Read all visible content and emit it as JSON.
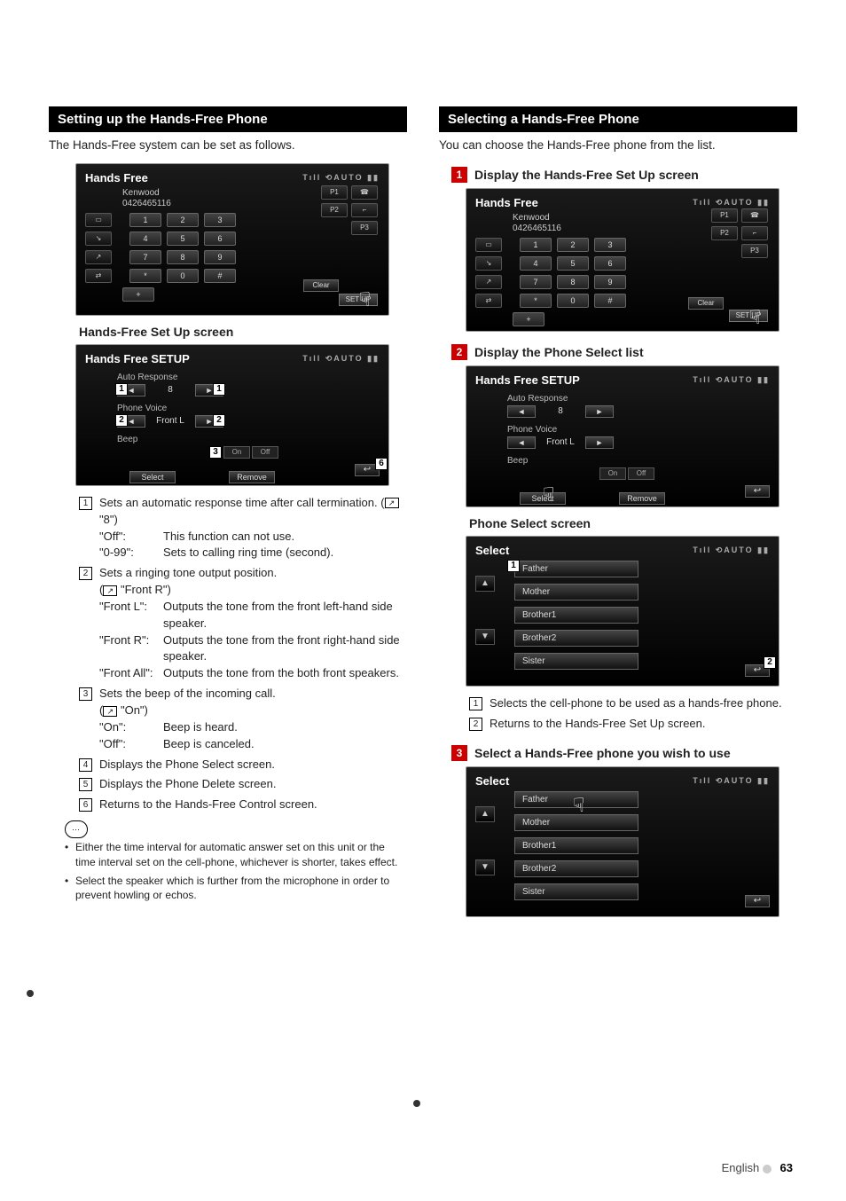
{
  "left": {
    "section_title": "Setting up the Hands-Free Phone",
    "intro": "The Hands-Free system can be set as follows.",
    "ss1": {
      "title": "Hands Free",
      "brand": "Kenwood",
      "number": "0426465116",
      "keys_r1": [
        "1",
        "2",
        "3"
      ],
      "keys_r2": [
        "4",
        "5",
        "6"
      ],
      "keys_r3": [
        "7",
        "8",
        "9"
      ],
      "keys_r4": [
        "*",
        "0",
        "#"
      ],
      "presets": [
        "P1",
        "P2",
        "P3"
      ],
      "clear": "Clear",
      "setup": "SET UP",
      "plus": "+"
    },
    "ss1_caption": "Hands-Free Set Up screen",
    "ss2": {
      "title": "Hands Free SETUP",
      "row1_label": "Auto Response",
      "row1_value": "8",
      "row2_label": "Phone Voice",
      "row2_value": "Front L",
      "row3_label": "Beep",
      "beep_on": "On",
      "beep_off": "Off",
      "select": "Select",
      "remove": "Remove"
    },
    "items": [
      {
        "n": "1",
        "text": "Sets an automatic response time after call termination. (",
        "setting": "\"8\")",
        "subs": [
          {
            "label": "\"Off\":",
            "desc": "This function can not use."
          },
          {
            "label": "\"0-99\":",
            "desc": "Sets to calling ring time (second)."
          }
        ]
      },
      {
        "n": "2",
        "text": "Sets a ringing tone output position.",
        "setting_only": "\"Front R\")",
        "subs": [
          {
            "label": "\"Front L\":",
            "desc": "Outputs the tone from the front left-hand side speaker."
          },
          {
            "label": "\"Front R\":",
            "desc": "Outputs the tone from the front right-hand side speaker."
          },
          {
            "label": "\"Front All\":",
            "desc": "Outputs the tone from the both front speakers."
          }
        ]
      },
      {
        "n": "3",
        "text": "Sets the beep of the incoming call.",
        "setting_only": "\"On\")",
        "subs": [
          {
            "label": "\"On\":",
            "desc": "Beep is heard."
          },
          {
            "label": "\"Off\":",
            "desc": "Beep is canceled."
          }
        ]
      },
      {
        "n": "4",
        "text": "Displays the Phone Select screen."
      },
      {
        "n": "5",
        "text": "Displays the Phone Delete screen."
      },
      {
        "n": "6",
        "text": "Returns to the Hands-Free Control screen."
      }
    ],
    "notes": [
      "Either the time interval for automatic answer set on this unit or the time interval set on the cell-phone, whichever is shorter, takes effect.",
      "Select the speaker which is further from the microphone in order to prevent howling or echos."
    ]
  },
  "right": {
    "section_title": "Selecting a Hands-Free Phone",
    "intro": "You can choose the Hands-Free phone from the list.",
    "step1": "Display the Hands-Free Set Up screen",
    "step2": "Display the Phone Select list",
    "ps_caption": "Phone Select screen",
    "select_title": "Select",
    "phones": [
      "Father",
      "Mother",
      "Brother1",
      "Brother2",
      "Sister"
    ],
    "items2": [
      {
        "n": "1",
        "text": "Selects the cell-phone to be used as a hands-free phone."
      },
      {
        "n": "2",
        "text": "Returns to the Hands-Free Set Up screen."
      }
    ],
    "step3": "Select a Hands-Free phone you wish to use"
  },
  "footer": {
    "lang": "English",
    "page": "63"
  }
}
